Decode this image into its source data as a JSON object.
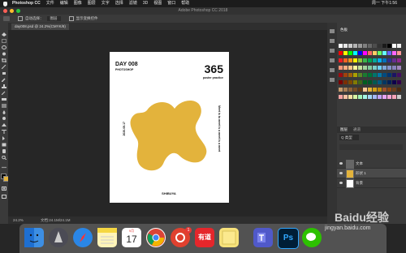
{
  "menubar": {
    "app": "Photoshop CC",
    "items": [
      "文件",
      "编辑",
      "图像",
      "图层",
      "文字",
      "选择",
      "滤镜",
      "3D",
      "视图",
      "窗口",
      "帮助"
    ],
    "clock": "周一 下午1:56"
  },
  "window": {
    "title": "Adobe Photoshop CC 2018"
  },
  "options": {
    "auto_select": "自动选择：",
    "target": "图层",
    "show_transform": "显示变换控件"
  },
  "document": {
    "tab": "day008.psd @ 24.2%(CMYK/8)",
    "zoom": "24.2%",
    "doc_size": "文档:24.1M/24.1M"
  },
  "artwork": {
    "day": "DAY 008",
    "subtitle": "PHOTOSHOP",
    "number": "365",
    "caption": "poster practice",
    "date": "2020.09.17",
    "vertical_text": "Meet is to meet is a meet is a meet",
    "footer": "SHIBUYA",
    "blob_color": "#E3B33C"
  },
  "panels": {
    "swatches_tab": "色板",
    "layers_tab": "图层",
    "channels_tab": "通道",
    "kind_label": "Q 类型"
  },
  "layers": [
    {
      "name": "文本"
    },
    {
      "name": "形状 1"
    },
    {
      "name": "背景"
    }
  ],
  "dock": {
    "apps": [
      "finder-icon",
      "launchpad-icon",
      "safari-icon",
      "notes-icon",
      "calendar-icon",
      "chrome-icon",
      "netease-music-icon",
      "youdao-icon",
      "stickies-icon",
      "teams-icon",
      "photoshop-icon",
      "wechat-icon"
    ],
    "calendar_day": "17",
    "calendar_month": "9月",
    "youdao_label": "有道",
    "ps_label": "Ps",
    "badge_count": "1"
  },
  "watermark": {
    "text": "Baidu经验",
    "sub": "jingyan.baidu.com"
  }
}
